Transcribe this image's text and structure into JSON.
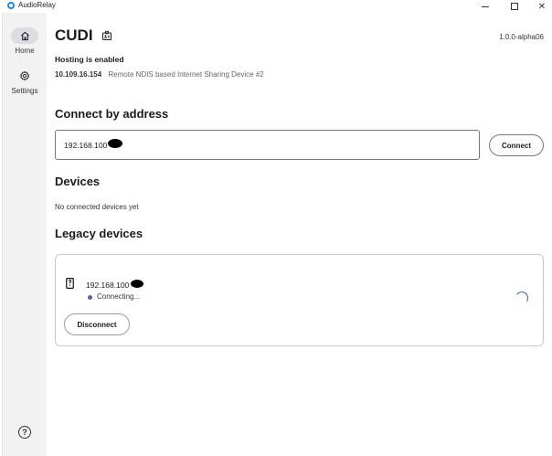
{
  "window": {
    "title": "AudioRelay",
    "minimize_icon": "minimize-icon",
    "maximize_icon": "maximize-icon",
    "close_icon": "close-icon",
    "close_glyph": "✕"
  },
  "sidebar": {
    "items": [
      {
        "label": "Home",
        "icon": "home-icon",
        "selected": true
      },
      {
        "label": "Settings",
        "icon": "gear-icon",
        "selected": false
      }
    ],
    "help_glyph": "?",
    "help_icon": "help-icon"
  },
  "header": {
    "device_name": "CUDI",
    "version": "1.0.0-alpha06",
    "badge_icon": "id-badge-icon"
  },
  "hosting": {
    "status": "Hosting is enabled",
    "ip": "10.109.16.154",
    "adapter": "Remote NDIS based Internet Sharing Device #2"
  },
  "connect": {
    "heading": "Connect by address",
    "input_value": "192.168.100",
    "button_label": "Connect"
  },
  "devices": {
    "heading": "Devices",
    "empty_text": "No connected devices yet"
  },
  "legacy": {
    "heading": "Legacy devices",
    "device": {
      "ip": "192.168.100",
      "status": "Connecting...",
      "device_icon": "phone-icon",
      "disconnect_label": "Disconnect"
    }
  },
  "colors": {
    "accent": "#5b5ea6",
    "sidebar_bg": "#f2f2f3",
    "selected_pill": "#dcdde3",
    "spinner": "#3b5998"
  }
}
